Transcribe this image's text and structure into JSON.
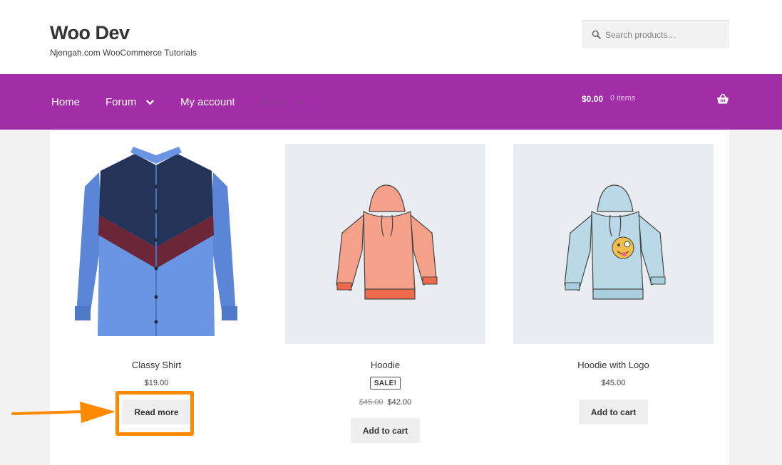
{
  "site": {
    "title": "Woo Dev",
    "tagline": "Njengah.com WooCommerce Tutorials"
  },
  "search": {
    "placeholder": "Search products…",
    "value": "",
    "icon": "search-icon"
  },
  "nav": {
    "items": [
      {
        "label": "Home",
        "has_dropdown": false
      },
      {
        "label": "Forum",
        "has_dropdown": true
      },
      {
        "label": "My account",
        "has_dropdown": false
      },
      {
        "label": "Shop",
        "has_dropdown": true
      }
    ],
    "cart": {
      "total": "$0.00",
      "count": "0 items",
      "icon": "basket-icon"
    }
  },
  "colors": {
    "nav_bg": "#a12ea7",
    "highlight": "#ff8a00",
    "button_bg": "#eeeeee"
  },
  "products": [
    {
      "name": "Classy Shirt",
      "price": "$19.00",
      "button": "Read more",
      "image": "blue-shirt-image"
    },
    {
      "name": "Hoodie",
      "sale_badge": "SALE!",
      "old_price": "$45.00",
      "price": "$42.00",
      "button": "Add to cart",
      "image": "pink-hoodie-image"
    },
    {
      "name": "Hoodie with Logo",
      "price": "$45.00",
      "button": "Add to cart",
      "image": "blue-hoodie-logo-image"
    }
  ]
}
